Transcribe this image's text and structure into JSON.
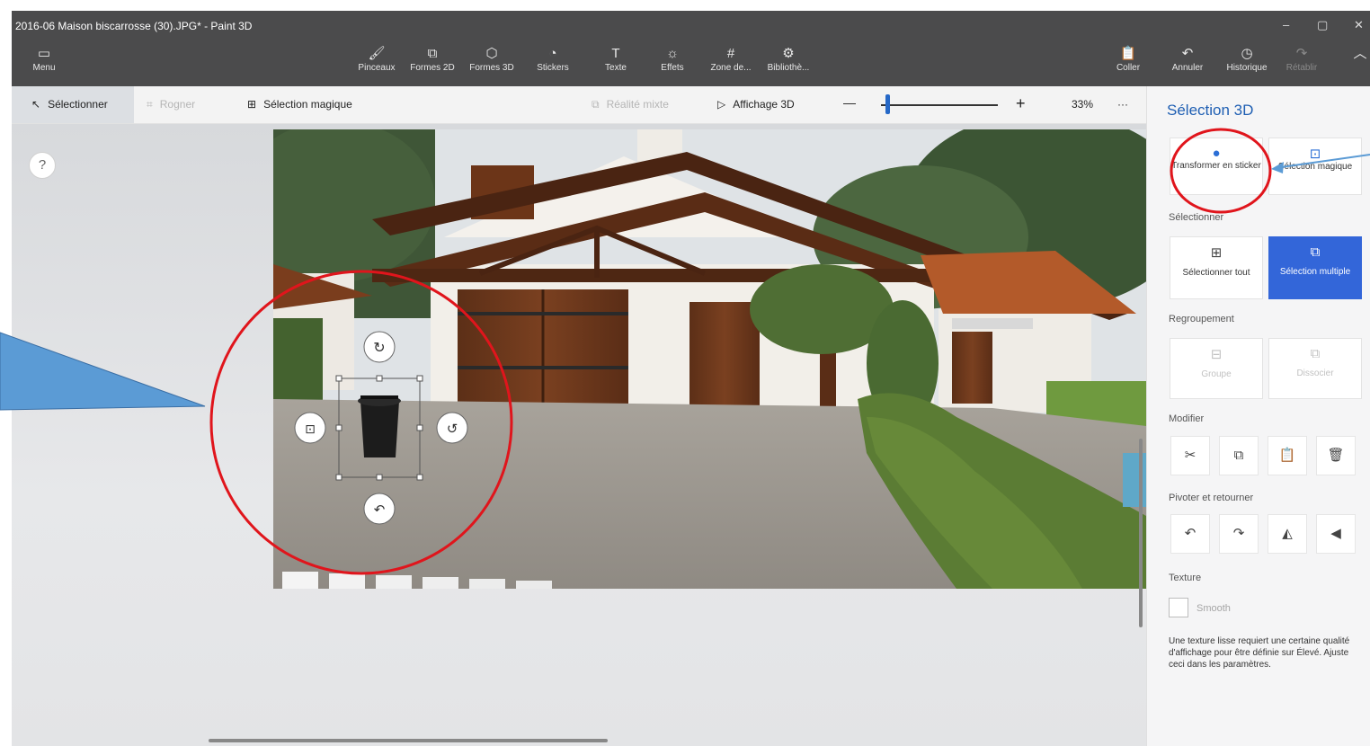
{
  "window": {
    "title": "2016-06 Maison biscarrosse (30).JPG* - Paint 3D",
    "minimize": "–",
    "restore": "▢",
    "close": "✕"
  },
  "ribbon": {
    "menu": "Menu",
    "tools": [
      {
        "label": "Pinceaux"
      },
      {
        "label": "Formes 2D"
      },
      {
        "label": "Formes 3D"
      },
      {
        "label": "Stickers"
      },
      {
        "label": "Texte"
      },
      {
        "label": "Effets"
      },
      {
        "label": "Zone de..."
      },
      {
        "label": "Bibliothè..."
      }
    ],
    "paste": "Coller",
    "undo": "Annuler",
    "history": "Historique",
    "redo": "Rétablir"
  },
  "toolbar": {
    "select": "Sélectionner",
    "crop": "Rogner",
    "magic_select": "Sélection magique",
    "mixed_reality": "Réalité mixte",
    "view_3d": "Affichage 3D",
    "zoom_minus": "—",
    "zoom_plus": "+",
    "zoom_level": "33%",
    "more": "···",
    "zoom_fraction": 0.06
  },
  "canvas": {
    "help": "?"
  },
  "panel": {
    "title": "Sélection 3D",
    "make_sticker": "Transformer en sticker",
    "magic_selection": "Sélection magique",
    "select_header": "Sélectionner",
    "select_all": "Sélectionner tout",
    "multi_select": "Sélection multiple",
    "group_header": "Regroupement",
    "group": "Groupe",
    "ungroup": "Dissocier",
    "modify_header": "Modifier",
    "rotate_header": "Pivoter et retourner",
    "texture_header": "Texture",
    "smooth": "Smooth",
    "texture_note": "Une texture lisse requiert une certaine qualité d'affichage pour être définie sur Élevé. Ajuste ceci dans les paramètres."
  },
  "colors": {
    "accent": "#3366d9",
    "title_blue": "#1f5fb3",
    "annotation_red": "#e0151c",
    "callout_blue": "#5b9bd5"
  }
}
